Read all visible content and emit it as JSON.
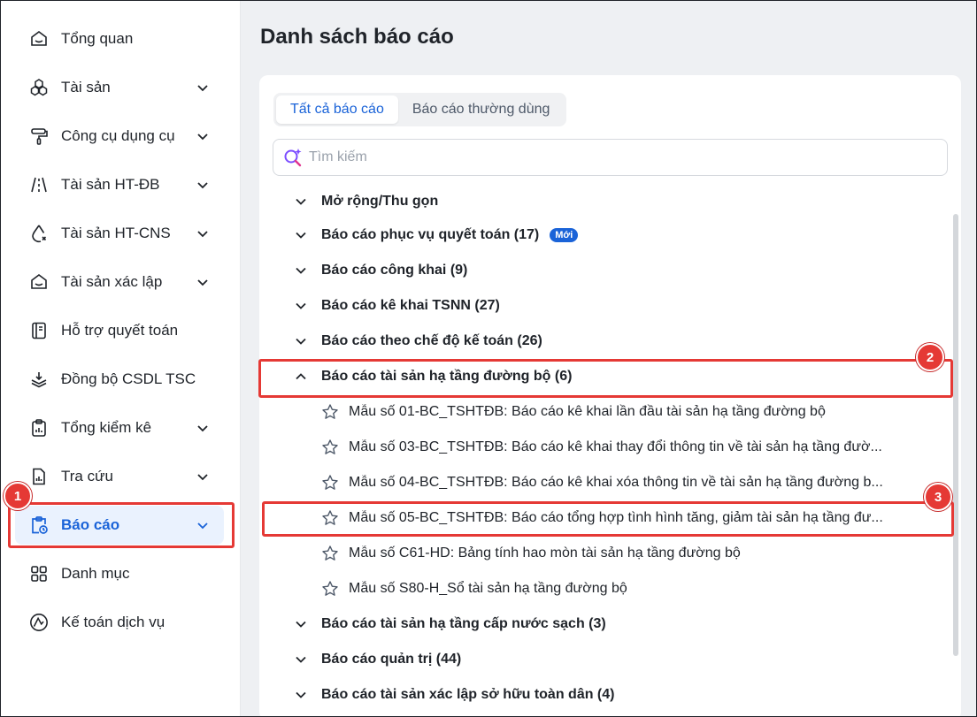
{
  "page_title": "Danh sách báo cáo",
  "sidebar": {
    "items": [
      {
        "label": "Tổng quan",
        "icon": "home-icon",
        "has_chevron": false
      },
      {
        "label": "Tài sản",
        "icon": "cubes-icon",
        "has_chevron": true
      },
      {
        "label": "Công cụ dụng cụ",
        "icon": "paint-roller-icon",
        "has_chevron": true
      },
      {
        "label": "Tài sản HT-ĐB",
        "icon": "road-icon",
        "has_chevron": true
      },
      {
        "label": "Tài sản HT-CNS",
        "icon": "water-drop-icon",
        "has_chevron": true
      },
      {
        "label": "Tài sản xác lập",
        "icon": "inbox-icon",
        "has_chevron": true
      },
      {
        "label": "Hỗ trợ quyết toán",
        "icon": "book-icon",
        "has_chevron": false
      },
      {
        "label": "Đồng bộ CSDL TSC",
        "icon": "layers-sync-icon",
        "has_chevron": false
      },
      {
        "label": "Tổng kiểm kê",
        "icon": "clipboard-icon",
        "has_chevron": true
      },
      {
        "label": "Tra cứu",
        "icon": "document-chart-icon",
        "has_chevron": true
      },
      {
        "label": "Báo cáo",
        "icon": "clipboard-clock-icon",
        "has_chevron": true,
        "active": true
      },
      {
        "label": "Danh mục",
        "icon": "grid-icon",
        "has_chevron": false
      },
      {
        "label": "Kế toán dịch vụ",
        "icon": "accounting-logo-icon",
        "has_chevron": false
      }
    ]
  },
  "tabs": [
    {
      "label": "Tất cả báo cáo",
      "active": true
    },
    {
      "label": "Báo cáo thường dùng",
      "active": false
    }
  ],
  "search": {
    "placeholder": "Tìm kiếm",
    "value": ""
  },
  "tree": {
    "expand_collapse": "Mở rộng/Thu gọn",
    "groups": [
      {
        "label": "Báo cáo phục vụ quyết toán (17)",
        "badge": "Mới"
      },
      {
        "label": "Báo cáo công khai (9)"
      },
      {
        "label": "Báo cáo kê khai TSNN (27)"
      },
      {
        "label": "Báo cáo theo chế độ kế toán (26)"
      },
      {
        "label": "Báo cáo tài sản hạ tầng đường bộ (6)",
        "expanded": true
      }
    ],
    "children": [
      "Mẫu số 01-BC_TSHTĐB: Báo cáo kê khai lần đầu tài sản hạ tầng đường bộ",
      "Mẫu số 03-BC_TSHTĐB: Báo cáo kê khai thay đổi thông tin về tài sản hạ tầng đườ...",
      "Mẫu số 04-BC_TSHTĐB: Báo cáo kê khai xóa thông tin về tài sản hạ tầng đường b...",
      "Mẫu số 05-BC_TSHTĐB: Báo cáo tổng hợp tình hình tăng, giảm tài sản hạ tầng đư...",
      "Mẫu số C61-HD: Bảng tính hao mòn tài sản hạ tầng đường bộ",
      "Mẫu số S80-H_Sổ tài sản hạ tầng đường bộ"
    ],
    "groups_after": [
      "Báo cáo tài sản hạ tầng cấp nước sạch (3)",
      "Báo cáo quản trị (44)",
      "Báo cáo tài sản xác lập sở hữu toàn dân (4)"
    ]
  },
  "annotations": [
    "1",
    "2",
    "3"
  ],
  "colors": {
    "accent": "#1a63d8",
    "highlight": "#e53935",
    "active_bg": "#eaf2fe"
  }
}
